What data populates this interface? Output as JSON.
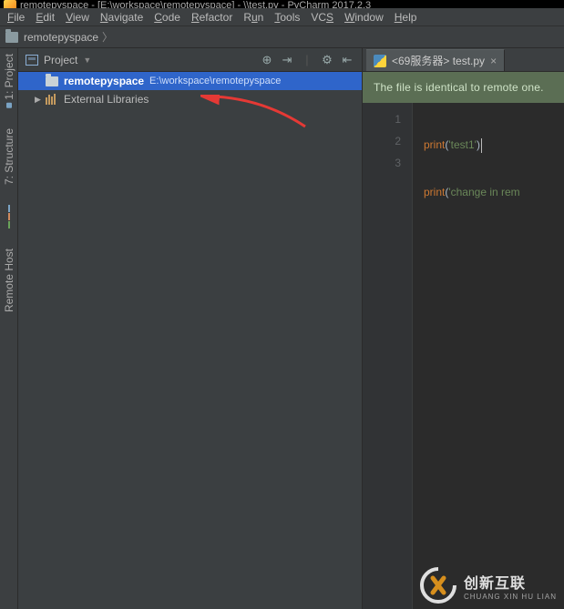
{
  "title": "remotepyspace - [E:\\workspace\\remotepyspace] - \\\\test.py - PyCharm 2017.2.3",
  "menu": {
    "items": [
      "File",
      "Edit",
      "View",
      "Navigate",
      "Code",
      "Refactor",
      "Run",
      "Tools",
      "VCS",
      "Window",
      "Help"
    ]
  },
  "breadcrumb": {
    "root": "remotepyspace"
  },
  "sidebar": {
    "stubs": {
      "project": "1: Project",
      "structure": "7: Structure",
      "remote": "Remote Host"
    }
  },
  "project": {
    "title": "Project",
    "tree": {
      "root": {
        "name": "remotepyspace",
        "path": "E:\\workspace\\remotepyspace"
      },
      "libs": "External Libraries"
    }
  },
  "editor": {
    "tab": {
      "label": "<69服务器> test.py"
    },
    "banner": "The file is identical to remote one.",
    "lines": [
      "1",
      "2",
      "3"
    ],
    "code": {
      "l1": {
        "kw": "print",
        "p1": "(",
        "str": "'test1'",
        "p2": ")"
      },
      "l2": {
        "kw": "print",
        "p1": "(",
        "str": "'change in rem",
        "p2": ""
      }
    }
  },
  "watermark": {
    "cn": "创新互联",
    "py": "CHUANG XIN HU LIAN"
  }
}
